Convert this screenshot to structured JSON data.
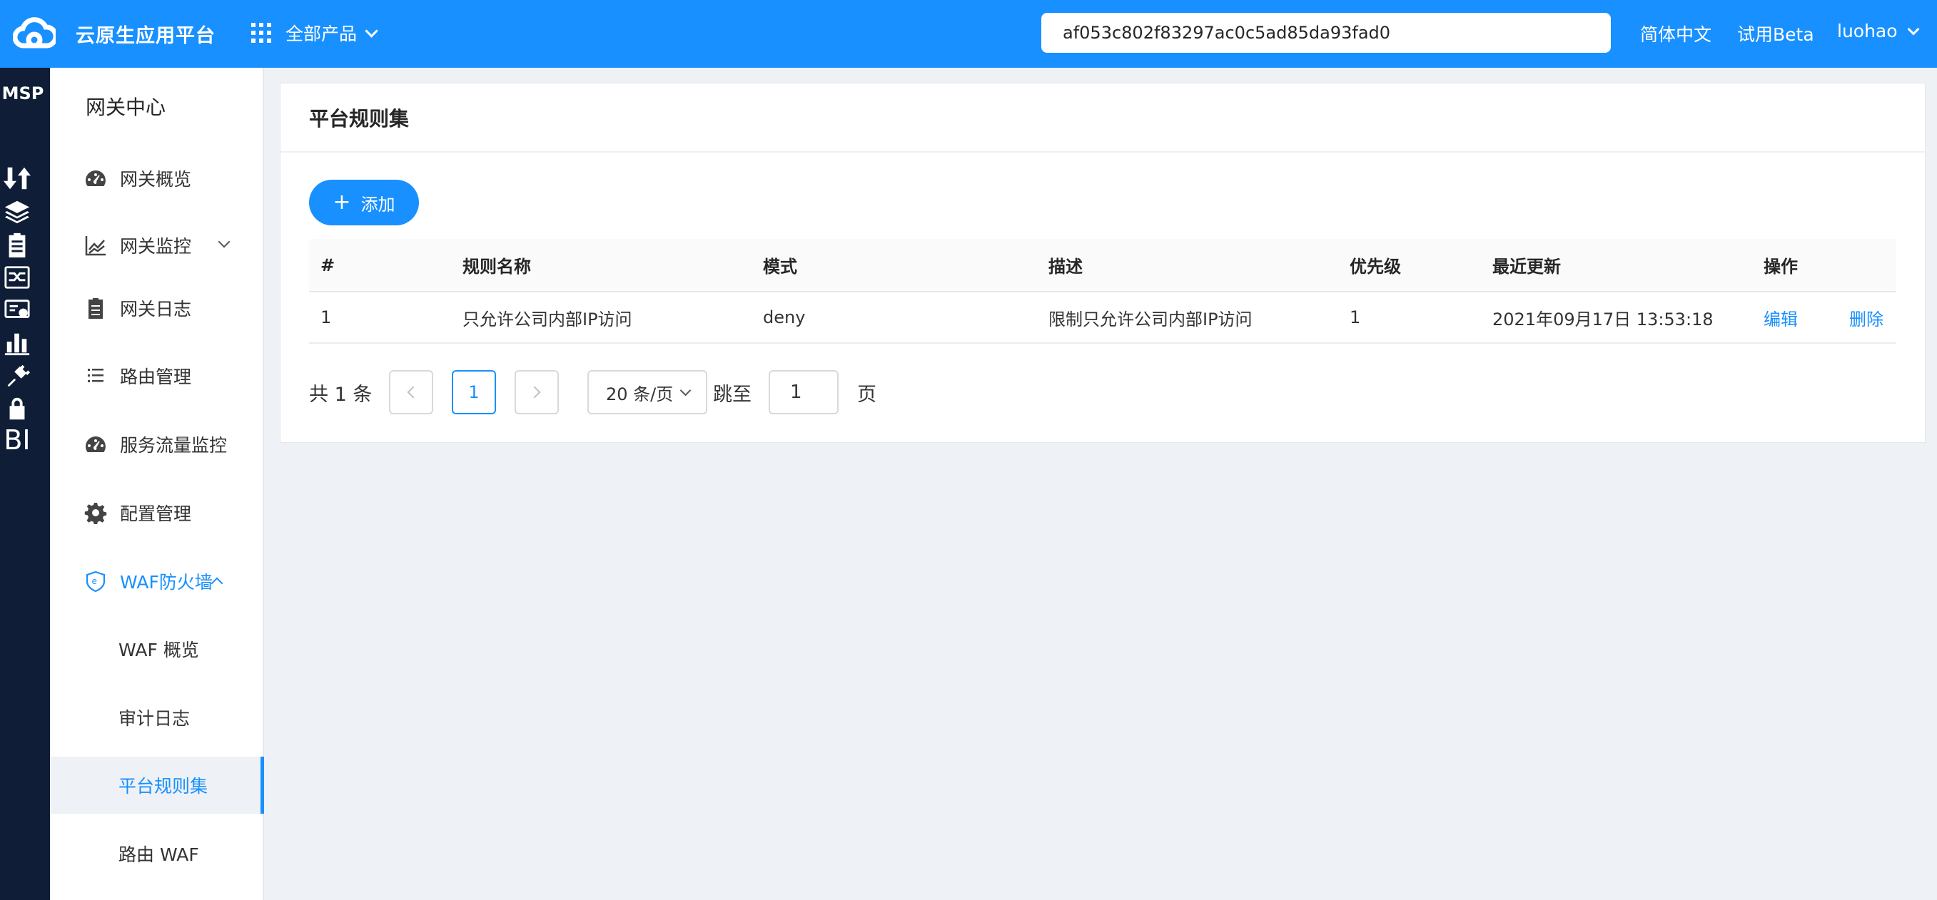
{
  "header": {
    "app_title": "云原生应用平台",
    "products_label": "全部产品",
    "search_value": "af053c802f83297ac0c5ad85da93fad0",
    "language": "简体中文",
    "beta": "试用Beta",
    "user": "luohao"
  },
  "rail": {
    "logo_text": "MSP",
    "icons": [
      "transfer-icon",
      "layers-icon",
      "clipboard-icon",
      "gateway-icon",
      "certificate-icon",
      "bar-chart-icon",
      "plug-icon",
      "lock-icon",
      "bi-icon"
    ],
    "bi_label": "BI"
  },
  "sidebar": {
    "title": "网关中心",
    "items": [
      {
        "label": "网关概览",
        "icon": "dashboard-icon"
      },
      {
        "label": "网关监控",
        "icon": "line-chart-icon"
      },
      {
        "label": "网关日志",
        "icon": "log-icon"
      },
      {
        "label": "路由管理",
        "icon": "list-icon"
      },
      {
        "label": "服务流量监控",
        "icon": "dashboard-icon"
      },
      {
        "label": "配置管理",
        "icon": "gear-icon"
      },
      {
        "label": "WAF防火墙",
        "icon": "shield-icon"
      }
    ],
    "waf_sub": [
      "WAF 概览",
      "审计日志",
      "平台规则集",
      "路由 WAF"
    ],
    "active": "平台规则集"
  },
  "main": {
    "title": "平台规则集",
    "add_label": "添加",
    "columns": [
      "#",
      "规则名称",
      "模式",
      "描述",
      "优先级",
      "最近更新",
      "操作"
    ],
    "rows": [
      {
        "index": "1",
        "name": "只允许公司内部IP访问",
        "mode": "deny",
        "description": "限制只允许公司内部IP访问",
        "priority": "1",
        "updated": "2021年09月17日 13:53:18",
        "edit": "编辑",
        "delete": "删除"
      }
    ],
    "pagination": {
      "total": "共 1 条",
      "current_page": "1",
      "page_size": "20 条/页",
      "jump_label": "跳至",
      "jump_value": "1",
      "page_label": "页"
    }
  },
  "colors": {
    "primary": "#1890ff",
    "rail_bg": "#0f1d36",
    "page_bg": "#eef1f5"
  }
}
